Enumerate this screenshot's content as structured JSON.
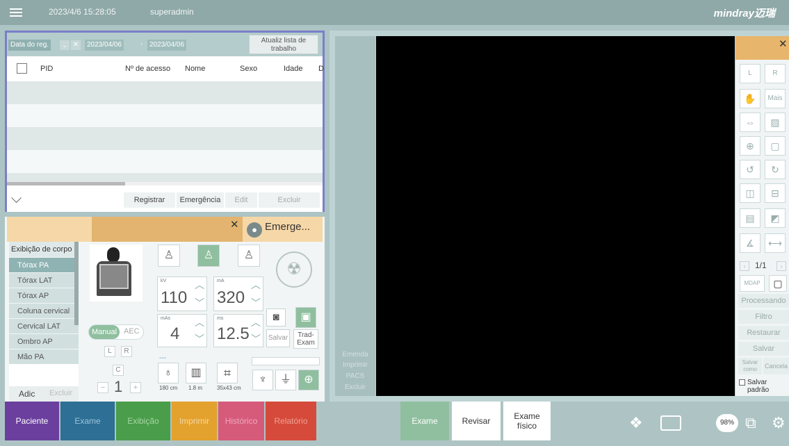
{
  "topbar": {
    "datetime": "2023/4/6 15:28:05",
    "user": "superadmin",
    "logo": "mindray迈瑞"
  },
  "worklist": {
    "filter_label": "Data do reg.",
    "date_from": "2023/04/06",
    "date_sep": "-",
    "date_to": "2023/04/06",
    "refresh_label": "Atualiz lista de trabalho",
    "columns": [
      "PID",
      "Nº de acesso",
      "Nome",
      "Sexo",
      "Idade",
      "D"
    ],
    "buttons": {
      "register": "Registrar",
      "emergency": "Emergência",
      "edit": "Edit",
      "delete": "Excluir"
    }
  },
  "exam": {
    "user_label": "Emerge...",
    "body_header": "Exibição de corpo",
    "body_items": [
      "Tórax PA",
      "Tórax LAT",
      "Tórax AP",
      "Coluna cervical",
      "Cervical LAT",
      "Ombro AP",
      "Mão PA"
    ],
    "add_label": "Adic",
    "delete_label": "Excluir",
    "kv_label": "kV",
    "kv_value": "110",
    "ma_label": "mA",
    "ma_value": "320",
    "mas_label": "mAs",
    "mas_value": "4",
    "ms_label": "ms",
    "ms_value": "12.5",
    "manual_label": "Manual",
    "aec_label": "AEC",
    "l_label": "L",
    "r_label": "R",
    "c_label": "C",
    "count_value": "1",
    "save_label": "Salvar",
    "trad_label": "Trad-Exam",
    "dash1": "---",
    "dash2": "----",
    "sid_value": "180 cm",
    "grid_value": "1.8 m",
    "size_value": "35x43 cm"
  },
  "viewer": {
    "side_buttons": [
      "Emenda",
      "Imprimir",
      "PACS",
      "Excluir"
    ],
    "tools": {
      "l": "L",
      "r": "R",
      "more": "Mais",
      "page": "1/1",
      "mdap": "MDAP"
    },
    "actions": [
      "Processando",
      "Filtro",
      "Restaurar",
      "Salvar"
    ],
    "save_as": "Salvar como",
    "cancel": "Cancela",
    "save_default": "Salvar padrão"
  },
  "nav": {
    "paciente": "Paciente",
    "exame": "Exame",
    "exibicao": "Exibição",
    "imprimir": "Imprimir",
    "historico": "Histórico",
    "relatorio": "Relatório"
  },
  "view_tabs": {
    "exame": "Exame",
    "revisar": "Revisar",
    "fisico": "Exame físico"
  },
  "status": {
    "battery": "98%"
  },
  "colors": {
    "paciente": "#6b3f9e",
    "exame": "#2d6f95",
    "exibicao": "#4a9d4a",
    "imprimir": "#e3a12d",
    "historico": "#d65a7a",
    "relatorio": "#d54a3a",
    "accent": "#e3b46f"
  }
}
